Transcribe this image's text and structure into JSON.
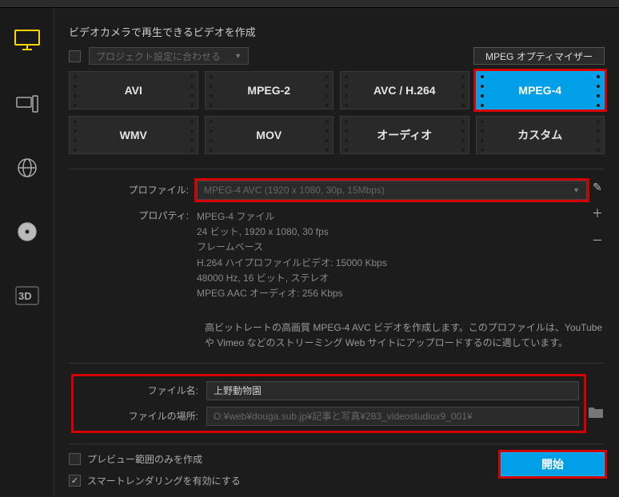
{
  "heading": "ビデオカメラで再生できるビデオを作成",
  "project_match_label": "プロジェクト設定に合わせる",
  "optimizer_button": "MPEG オプティマイザー",
  "formats": {
    "avi": "AVI",
    "mpeg2": "MPEG-2",
    "avc": "AVC / H.264",
    "mpeg4": "MPEG-4",
    "wmv": "WMV",
    "mov": "MOV",
    "audio": "オーディオ",
    "custom": "カスタム"
  },
  "labels": {
    "profile": "プロファイル:",
    "property": "プロパティ:",
    "filename": "ファイル名:",
    "filelocation": "ファイルの場所:"
  },
  "profile_selected": "MPEG-4 AVC (1920 x 1080, 30p, 15Mbps)",
  "properties": {
    "l1": "MPEG-4 ファイル",
    "l2": "24 ビット, 1920 x 1080, 30 fps",
    "l3": "フレームベース",
    "l4": "H.264 ハイプロファイルビデオ: 15000 Kbps",
    "l5": "48000 Hz, 16 ビット, ステレオ",
    "l6": "MPEG AAC オーディオ: 256 Kbps"
  },
  "description": "高ビットレートの高画質 MPEG-4 AVC ビデオを作成します。このプロファイルは、YouTube や Vimeo などのストリーミング Web サイトにアップロードするのに適しています。",
  "filename_value": "上野動物園",
  "filelocation_value": "O:¥web¥douga.sub.jp¥記事と写真¥283_videostudiox9_001¥",
  "preview_only": "プレビュー範囲のみを作成",
  "smart_render": "スマートレンダリングを有効にする",
  "start": "開始"
}
